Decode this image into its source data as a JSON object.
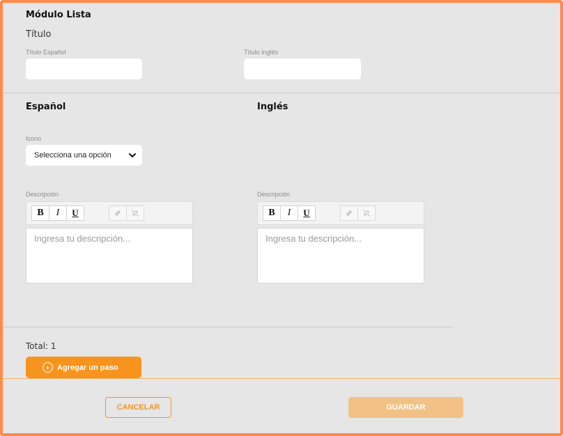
{
  "module": {
    "title": "Módulo Lista",
    "subtitle": "Título"
  },
  "title_fields": {
    "spanish_label": "Título Español",
    "english_label": "Título Inglés",
    "spanish_value": "",
    "english_value": ""
  },
  "columns": {
    "spanish_heading": "Español",
    "english_heading": "Inglés"
  },
  "icon_select": {
    "label": "Icono",
    "selected": "Selecciona una opción"
  },
  "editors": {
    "spanish": {
      "label": "Descripción",
      "placeholder": "Ingresa tu descripción..."
    },
    "english": {
      "label": "Descripción",
      "placeholder": "Ingresa tu descripción..."
    },
    "toolbar": {
      "bold": "B",
      "italic": "I",
      "underline": "U"
    }
  },
  "steps": {
    "total_text": "Total: 1",
    "add_label": "Agregar un paso"
  },
  "footer": {
    "cancel_label": "CANCELAR",
    "save_label": "GUARDAR"
  },
  "colors": {
    "accent": "#f7941d",
    "border": "#ff8a4c",
    "disabled": "#f2c185"
  }
}
